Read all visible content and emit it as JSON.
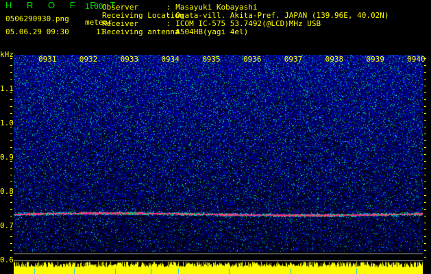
{
  "header": {
    "app_title": "H R O F F T",
    "version": "1.00",
    "filename": "0506290930.png",
    "datetime": "05.06.29 09:30",
    "meteor_label": "meteor",
    "meteor_count": "11",
    "info": [
      {
        "label": "Observer",
        "value": ": Masayuki Kobayashi"
      },
      {
        "label": "Receiving Location",
        "value": ": Ogata-vill. Akita-Pref. JAPAN (139.96E, 40.02N)"
      },
      {
        "label": "Receiver",
        "value": ": ICOM IC-575 53.7492(@LCD)MHz USB"
      },
      {
        "label": "Receiving antenna",
        "value": ": A504HB(yagi 4el)"
      }
    ]
  },
  "chart_data": {
    "type": "heatmap",
    "ylabel": "kHz",
    "x_ticks": [
      "0931",
      "0932",
      "0933",
      "0934",
      "0935",
      "0936",
      "0937",
      "0938",
      "0939",
      "0940"
    ],
    "y_ticks": [
      "1.1",
      "1.0",
      "0.9",
      "0.8",
      "0.7",
      "0.6"
    ],
    "ylim": [
      0.6,
      1.2
    ],
    "carrier_line_khz": 0.735,
    "colors": {
      "background": "#000010",
      "noise": "#1020d0",
      "signal": "#ff2080",
      "level_bars": "#ffff00",
      "text": "#ffff00"
    }
  }
}
